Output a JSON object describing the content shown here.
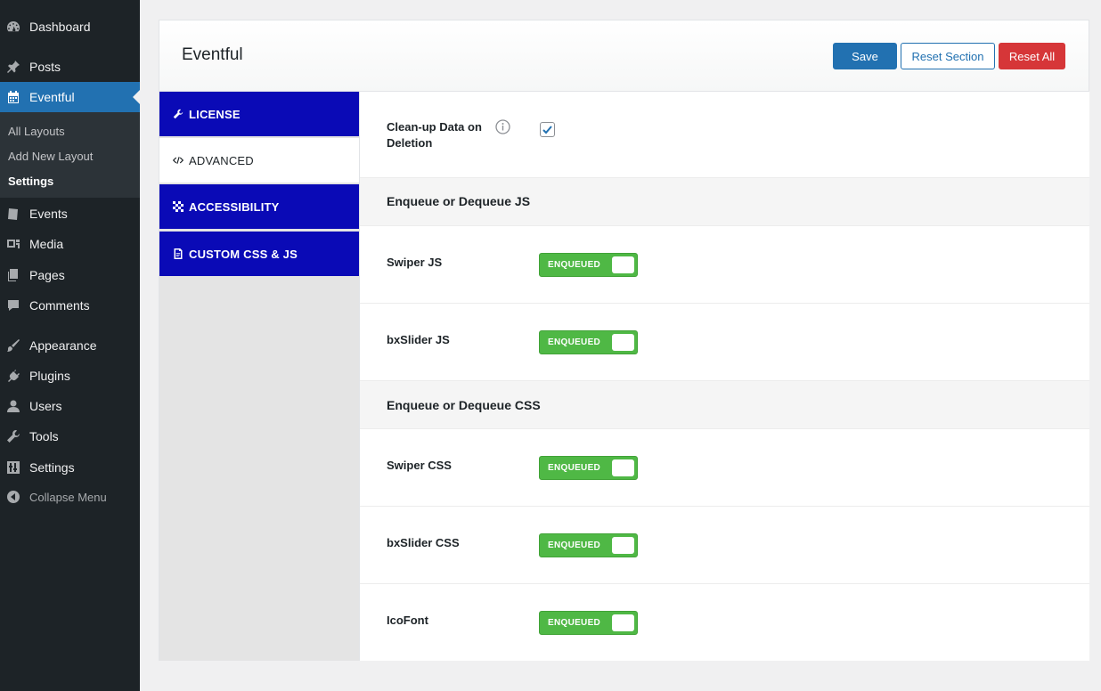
{
  "admin_menu": {
    "items": [
      {
        "label": "Dashboard",
        "icon": "dashboard-icon"
      },
      {
        "label": "Posts",
        "icon": "pin-icon"
      },
      {
        "label": "Eventful",
        "icon": "calendar-icon"
      },
      {
        "label": "Events",
        "icon": "events-icon"
      },
      {
        "label": "Media",
        "icon": "media-icon"
      },
      {
        "label": "Pages",
        "icon": "pages-icon"
      },
      {
        "label": "Comments",
        "icon": "comment-icon"
      },
      {
        "label": "Appearance",
        "icon": "brush-icon"
      },
      {
        "label": "Plugins",
        "icon": "plug-icon"
      },
      {
        "label": "Users",
        "icon": "user-icon"
      },
      {
        "label": "Tools",
        "icon": "wrench-icon"
      },
      {
        "label": "Settings",
        "icon": "sliders-icon"
      }
    ],
    "submenu": [
      "All Layouts",
      "Add New Layout",
      "Settings"
    ],
    "collapse_label": "Collapse Menu",
    "accent_color": "#2271b1"
  },
  "panel": {
    "title": "Eventful",
    "buttons": {
      "save": "Save",
      "reset_section": "Reset Section",
      "reset_all": "Reset All"
    }
  },
  "tabs": [
    {
      "label": "LICENSE",
      "icon": "wrench-icon"
    },
    {
      "label": "ADVANCED",
      "icon": "code-icon"
    },
    {
      "label": "ACCESSIBILITY",
      "icon": "checker-icon"
    },
    {
      "label": "CUSTOM CSS & JS",
      "icon": "file-code-icon"
    }
  ],
  "content": {
    "cleanup_label": "Clean-up Data on Deletion",
    "cleanup_checked": true,
    "js_heading": "Enqueue or Dequeue JS",
    "css_heading": "Enqueue or Dequeue CSS",
    "js_fields": [
      {
        "label": "Swiper JS",
        "state": "ENQUEUED"
      },
      {
        "label": "bxSlider JS",
        "state": "ENQUEUED"
      }
    ],
    "css_fields": [
      {
        "label": "Swiper CSS",
        "state": "ENQUEUED"
      },
      {
        "label": "bxSlider CSS",
        "state": "ENQUEUED"
      },
      {
        "label": "IcoFont",
        "state": "ENQUEUED"
      }
    ],
    "toggle_color": "#4fb845"
  }
}
